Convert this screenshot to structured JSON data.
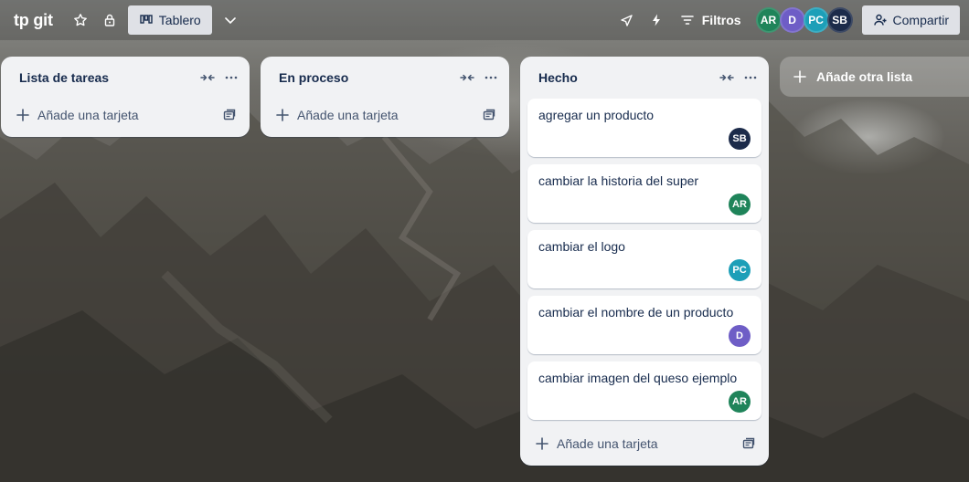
{
  "header": {
    "board_title": "tp git",
    "view_label": "Tablero",
    "filters_label": "Filtros",
    "share_label": "Compartir",
    "members": [
      {
        "initials": "AR",
        "color": "#1f845a"
      },
      {
        "initials": "D",
        "color": "#6e5dc6"
      },
      {
        "initials": "PC",
        "color": "#1d9fb8"
      },
      {
        "initials": "SB",
        "color": "#1c2b4a"
      }
    ]
  },
  "lists": [
    {
      "title": "Lista de tareas",
      "add_card_label": "Añade una tarjeta",
      "cards": []
    },
    {
      "title": "En proceso",
      "add_card_label": "Añade una tarjeta",
      "cards": []
    },
    {
      "title": "Hecho",
      "add_card_label": "Añade una tarjeta",
      "cards": [
        {
          "title": "agregar un producto",
          "member": "SB",
          "member_color": "#1c2b4a"
        },
        {
          "title": "cambiar la historia del super",
          "member": "AR",
          "member_color": "#1f845a"
        },
        {
          "title": "cambiar el logo",
          "member": "PC",
          "member_color": "#1d9fb8"
        },
        {
          "title": "cambiar el nombre de un producto",
          "member": "D",
          "member_color": "#6e5dc6"
        },
        {
          "title": "cambiar imagen del queso ejemplo",
          "member": "AR",
          "member_color": "#1f845a"
        }
      ]
    }
  ],
  "add_list_label": "Añade otra lista"
}
